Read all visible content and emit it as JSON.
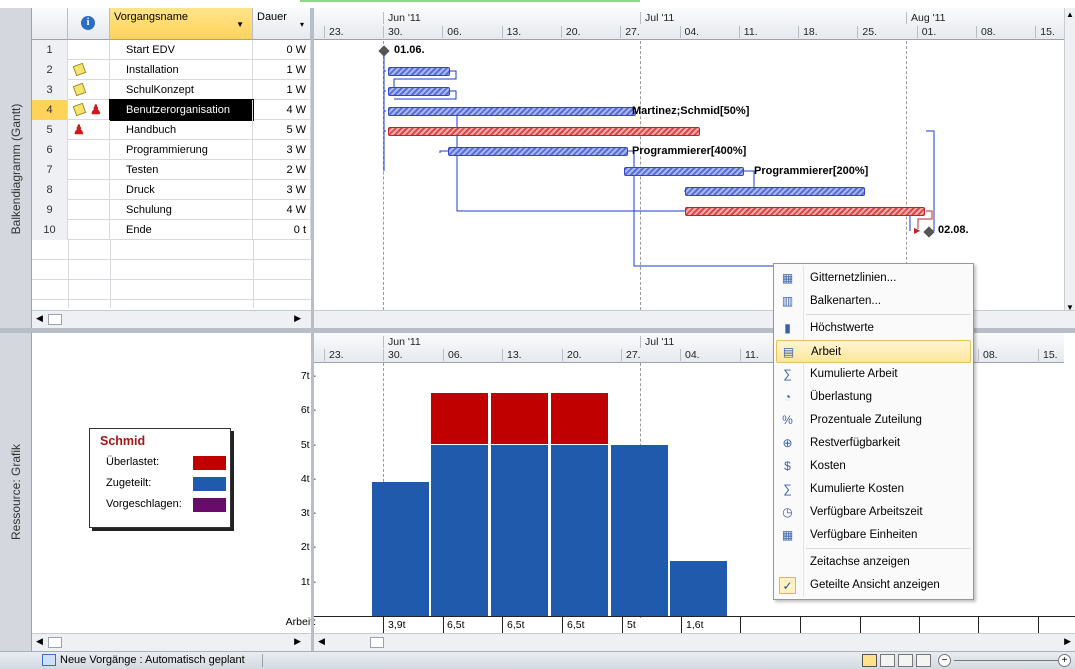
{
  "gantt": {
    "side_label": "Balkendiagramm (Gantt)",
    "headers": {
      "info_icon": "info-icon",
      "name": "Vorgangsname",
      "duration": "Dauer"
    },
    "timeline": {
      "months": [
        "Jun '11",
        "Jul '11",
        "Aug '11"
      ],
      "weeks": [
        "23.",
        "30.",
        "06.",
        "13.",
        "20.",
        "27.",
        "04.",
        "11.",
        "18.",
        "25.",
        "01.",
        "08.",
        "15."
      ]
    },
    "rows": [
      {
        "num": "1",
        "name": "Start EDV",
        "duration": "0 W",
        "indicators": []
      },
      {
        "num": "2",
        "name": "Installation",
        "duration": "1 W",
        "indicators": [
          "note-icon"
        ]
      },
      {
        "num": "3",
        "name": "SchulKonzept",
        "duration": "1 W",
        "indicators": [
          "note-icon"
        ]
      },
      {
        "num": "4",
        "name": "Benutzerorganisation",
        "duration": "4 W",
        "indicators": [
          "note-icon",
          "overallocated-person-icon"
        ]
      },
      {
        "num": "5",
        "name": "Handbuch",
        "duration": "5 W",
        "indicators": [
          "overallocated-person-icon"
        ]
      },
      {
        "num": "6",
        "name": "Programmierung",
        "duration": "3 W",
        "indicators": []
      },
      {
        "num": "7",
        "name": "Testen",
        "duration": "2 W",
        "indicators": []
      },
      {
        "num": "8",
        "name": "Druck",
        "duration": "3 W",
        "indicators": []
      },
      {
        "num": "9",
        "name": "Schulung",
        "duration": "4 W",
        "indicators": []
      },
      {
        "num": "10",
        "name": "Ende",
        "duration": "0 t",
        "indicators": []
      }
    ],
    "bar_labels": {
      "start": "01.06.",
      "row4": "Martinez;Schmid[50%]",
      "row6": "Programmierer[400%]",
      "row7": "Programmierer[200%]",
      "end": "02.08."
    }
  },
  "resource": {
    "side_label": "Ressource: Grafik",
    "months": [
      "Jun '11",
      "Jul '11"
    ],
    "weeks": [
      "23.",
      "30.",
      "06.",
      "13.",
      "20.",
      "27.",
      "04.",
      "11.",
      "08.",
      "15."
    ],
    "legend": {
      "name": "Schmid",
      "items": [
        {
          "label": "Überlastet:",
          "color": "#c00000"
        },
        {
          "label": "Zugeteilt:",
          "color": "#1f5aad"
        },
        {
          "label": "Vorgeschlagen:",
          "color": "#6a0a6a"
        }
      ]
    },
    "y_ticks": [
      "7t",
      "6t",
      "5t",
      "4t",
      "3t",
      "2t",
      "1t"
    ],
    "row_label": "Arbeit:",
    "value_labels": [
      "3,9t",
      "6,5t",
      "6,5t",
      "6,5t",
      "5t",
      "1,6t"
    ]
  },
  "chart_data": {
    "type": "bar",
    "title": "Schmid",
    "ylabel": "",
    "xlabel": "",
    "ylim": [
      0,
      7.5
    ],
    "categories": [
      "30.",
      "06.",
      "13.",
      "20.",
      "27.",
      "04."
    ],
    "series": [
      {
        "name": "Zugeteilt:",
        "values": [
          3.9,
          5,
          5,
          5,
          5,
          1.6
        ],
        "color": "#1f5aad"
      },
      {
        "name": "Überlastet:",
        "values": [
          0,
          1.5,
          1.5,
          1.5,
          0,
          0
        ],
        "color": "#c00000"
      }
    ]
  },
  "context_menu": {
    "items": [
      {
        "label": "Gitternetzlinien...",
        "icon": "gridlines-icon",
        "highlight": false
      },
      {
        "label": "Balkenarten...",
        "icon": "bar-styles-icon",
        "highlight": false
      },
      {
        "label": "Höchstwerte",
        "icon": "peak-units-icon",
        "highlight": false
      },
      {
        "label": "Arbeit",
        "icon": "work-icon",
        "highlight": true
      },
      {
        "label": "Kumulierte Arbeit",
        "icon": "cumulative-work-icon",
        "highlight": false
      },
      {
        "label": "Überlastung",
        "icon": "overallocation-icon",
        "highlight": false
      },
      {
        "label": "Prozentuale Zuteilung",
        "icon": "percent-allocation-icon",
        "highlight": false
      },
      {
        "label": "Restverfügbarkeit",
        "icon": "remaining-availability-icon",
        "highlight": false
      },
      {
        "label": "Kosten",
        "icon": "cost-icon",
        "highlight": false
      },
      {
        "label": "Kumulierte Kosten",
        "icon": "cumulative-cost-icon",
        "highlight": false
      },
      {
        "label": "Verfügbare Arbeitszeit",
        "icon": "work-availability-icon",
        "highlight": false
      },
      {
        "label": "Verfügbare Einheiten",
        "icon": "unit-availability-icon",
        "highlight": false
      },
      {
        "label": "Zeitachse anzeigen",
        "icon": "",
        "highlight": false
      },
      {
        "label": "Geteilte Ansicht anzeigen",
        "icon": "checkmark-icon",
        "highlight": false
      }
    ]
  },
  "status_bar": {
    "new_tasks": "Neue Vorgänge : Automatisch geplant"
  }
}
